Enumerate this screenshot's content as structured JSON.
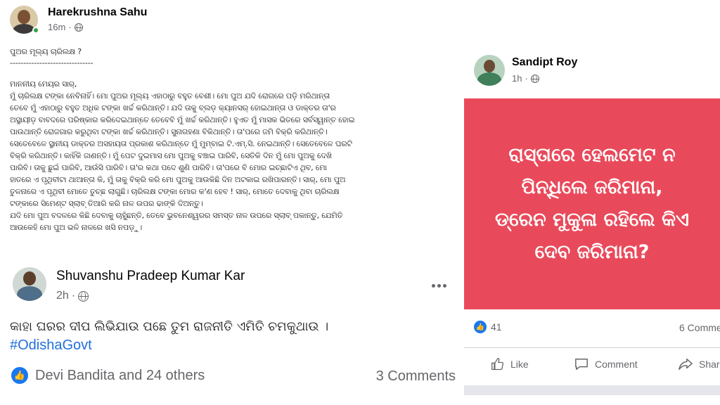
{
  "post1": {
    "author": "Harekrushna Sahu",
    "time": "16m",
    "separator": "·",
    "title_line": "ପୁଅର ମୂଲ୍ୟ ଚାରିଲକ୍ଷ ?",
    "rule": "-------------------------------",
    "body_lines": [
      "ମାନନୀୟ ମେୟର ସାର୍,",
      "ମୁଁ ଚାରିଲକ୍ଷ ଟଙ୍କା ନେବିନାହିଁ। ମୋ ପୁଅର ମୂଲ୍ୟ ଏହାଠାରୁ ବହୁତ ବେଶୀ। ମୋ ପୁଅ ଯଦି ରୋଗରେ ପଡ଼ି ମରିଥାନ୍ତା",
      "ତେବେ ମୁଁ ଏହାଠାରୁ ବହୁତ ଅଧିକ ଟଙ୍କା ଖର୍ଚ୍ଚ କରିଥାନ୍ତି। ଯଦି ତାକୁ ବ୍ଲଡ଼ କ୍ୟାନସର୍ ହୋଇଥାନ୍ତା ଓ ଡାକ୍ତର ତା'ର",
      "ଅସ୍ଥାୟୀଡ଼ ବାବଦରେ ପରିଷ୍କାର କରିଦେଇଥାନ୍ତେ ତେବେବି ମୁଁ ଖର୍ଚ୍ଚ କରିଥାନ୍ତି। ହୁଏତ ମୁଁ ମାସକ ଭିତରେ ସର୍ବସ୍ୱାନ୍ତ ହୋଇ",
      "ପାଉଥାନ୍ତି ରୋଜଗାର କରୁଥିବା ଟଙ୍କା ଖର୍ଚ୍ଚ କରିଥାନ୍ତି। ସୁନାଗହଣା ବିକିଥାନ୍ତି। ତା'ପରେ ଜମି ବିକ୍ରି କରିଥାନ୍ତି।",
      "ସେତେବେଳେ ସ୍ଥାନୀୟ ଡାକ୍ତର ଅସହାୟତା ପ୍ରକାଶ କରିଥାନ୍ତେ ମୁଁ ମୁମ୍ବାଇ ଟି.ଏମ୍.ସି. ନେଇଥାନ୍ତି। ସେତେବେଳେ ଘରଟି",
      "ବିକ୍ରି କରିଥାନ୍ତି। କାହିଁକି ଜାଣନ୍ତି। ମୁଁ ପେଟ ଦୁଇମାସ ମୋ ପୁଅକୁ ବଞ୍ଚାଇ ପାରିବି, ସେତିକି ଦିନ ମୁଁ ମୋ ପୁଅକୁ ଦେଖି",
      "ପାରିବି। ତାକୁ ଛୁଇଁ ପାରିବି, ଆଉଁସି ପାରିବି। ତା'ର କଥା ପଦେ ଶୁଣି ପାରିବି। ତା'ପରେ ବି ମୋର ଇଚ୍ଛାଟିଏ ଥିବ, ମୋ",
      "ହାତରେ ଏ ପୃଥିବୀଟା ଥାଆନ୍ତା କି, ମୁଁ ତାକୁ ବିକ୍ରି କରି ମୋ ପୁଅକୁ ଆଉକିଛି ଦିନ ଅଟକାଇ ରଖିପାରନ୍ତି। ସାର୍, ମୋ ପୁଅ",
      "ତୁଳନାରେ ଏ ପୃଥିବୀ ମୋତେ ତୁଚ୍ଛ ଲାଗୁଛି। ଚାରିଲକ୍ଷ ଟଙ୍କା ମୋର କ'ଣ ହେବ ! ସାର୍, ମୋତେ ଦେବାକୁ ଥିବା ଚାରିଲକ୍ଷ",
      "ଟଙ୍କାରେ ସିମେଣ୍ଟ ସ୍ଲାବ୍ ତିଆରି କରି ନାଳ ଉପର ଢାଙ୍କି ଦିଅନ୍ତୁ।",
      "ଯଦି ମୋ ପୁଅ ବଦଳରେ କିଛି ଦେବାକୁ ଚାହୁଁଛନ୍ତି, ତେବେ ଭୁବନେଶ୍ୱରର ସମସ୍ତ ନାଳ ଉପରେ ସ୍ଲାବ୍ ପକାନ୍ତୁ, ଯେମିତି",
      "ଆଉକେହି ମୋ ପୁଅ ଭଳି ନାଳରେ ଖସି ନପଡ଼ୁ।"
    ]
  },
  "post2": {
    "author": "Shuvanshu Pradeep Kumar Kar",
    "time": "2h",
    "separator": "·",
    "body": "କାହା ଘରର ଦୀପ ଲିଭିଯାଉ ପଛେ ତୁମ ରାଜନୀତି ଏମିତି ଚମକୁଥାଉ ।",
    "hashtag": "#OdishaGovt",
    "reactions": "Devi Bandita and 24 others",
    "comments": "3 Comments"
  },
  "post3": {
    "author": "Sandipt Roy",
    "time": "1h",
    "separator": "·",
    "card_text": "ରାସ୍ତାରେ ହେଲମେଟ ନ\nପିନ୍ଧିଲେ ଜରିମାନା,\nଡ୍ରେନ ମୁକୁଳା ରହିଲେ କିଏ\nଦେବ ଜରିମାନା?",
    "like_count": "41",
    "comments": "6 Comme",
    "actions": {
      "like": "Like",
      "comment": "Comment",
      "share": "Share"
    }
  },
  "colors": {
    "card_bg": "#e94a5b",
    "facebook_blue": "#1877f2",
    "hashtag": "#216fdb",
    "muted": "#65676b",
    "online": "#31a24c"
  },
  "icons": [
    "globe-icon",
    "online-indicator",
    "more-options-icon",
    "like-reaction-icon",
    "like-icon",
    "comment-icon",
    "share-icon"
  ]
}
